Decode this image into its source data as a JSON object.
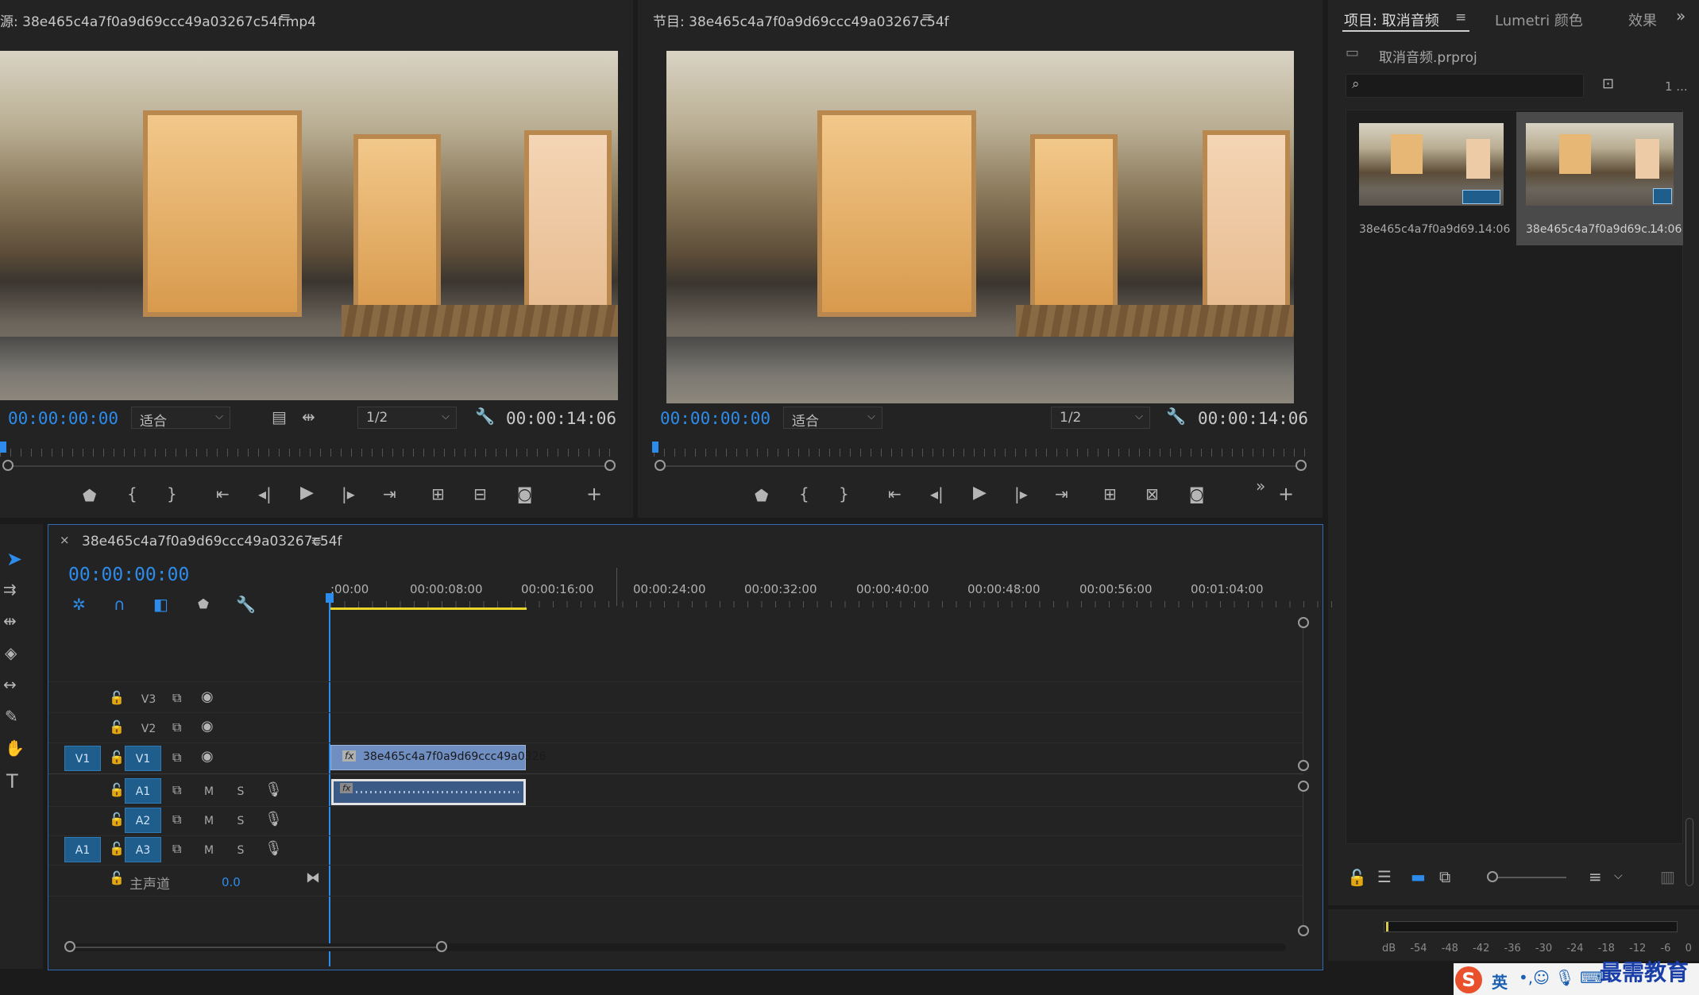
{
  "source_panel": {
    "title": "源: 38e465c4a7f0a9d69ccc49a03267c54f.mp4",
    "timecode": "00:00:00:00",
    "fit": "适合",
    "resolution": "1/2",
    "duration": "00:00:14:06"
  },
  "program_panel": {
    "title": "节目: 38e465c4a7f0a9d69ccc49a03267c54f",
    "timecode": "00:00:00:00",
    "fit": "适合",
    "resolution": "1/2",
    "duration": "00:00:14:06"
  },
  "project_panel": {
    "tabs": [
      "项目: 取消音频",
      "Lumetri 颜色",
      "效果"
    ],
    "project_file": "取消音频.prproj",
    "count": "1 ...",
    "items": [
      {
        "name": "38e465c4a7f0a9d69...",
        "duration": "14:06"
      },
      {
        "name": "38e465c4a7f0a9d69c...",
        "duration": "14:06"
      }
    ]
  },
  "timeline": {
    "sequence_name": "38e465c4a7f0a9d69ccc49a03267c54f",
    "timecode": "00:00:00:00",
    "ruler": [
      ":00:00",
      "00:00:08:00",
      "00:00:16:00",
      "00:00:24:00",
      "00:00:32:00",
      "00:00:40:00",
      "00:00:48:00",
      "00:00:56:00",
      "00:01:04:00"
    ],
    "tracks": {
      "v3": "V3",
      "v2": "V2",
      "v1": "V1",
      "v1_src": "V1",
      "a1": "A1",
      "a2": "A2",
      "a3": "A3",
      "a1_src": "A1",
      "m": "M",
      "s": "S",
      "master": "主声道",
      "master_value": "0.0"
    },
    "clip_name": "38e465c4a7f0a9d69ccc49a0326",
    "fx": "fx"
  },
  "meter": {
    "labels": [
      "dB",
      "-54",
      "-48",
      "-42",
      "-36",
      "-30",
      "-24",
      "-18",
      "-12",
      "-6",
      "0"
    ]
  },
  "ime": {
    "lang": "英",
    "brand": "最需教育"
  }
}
